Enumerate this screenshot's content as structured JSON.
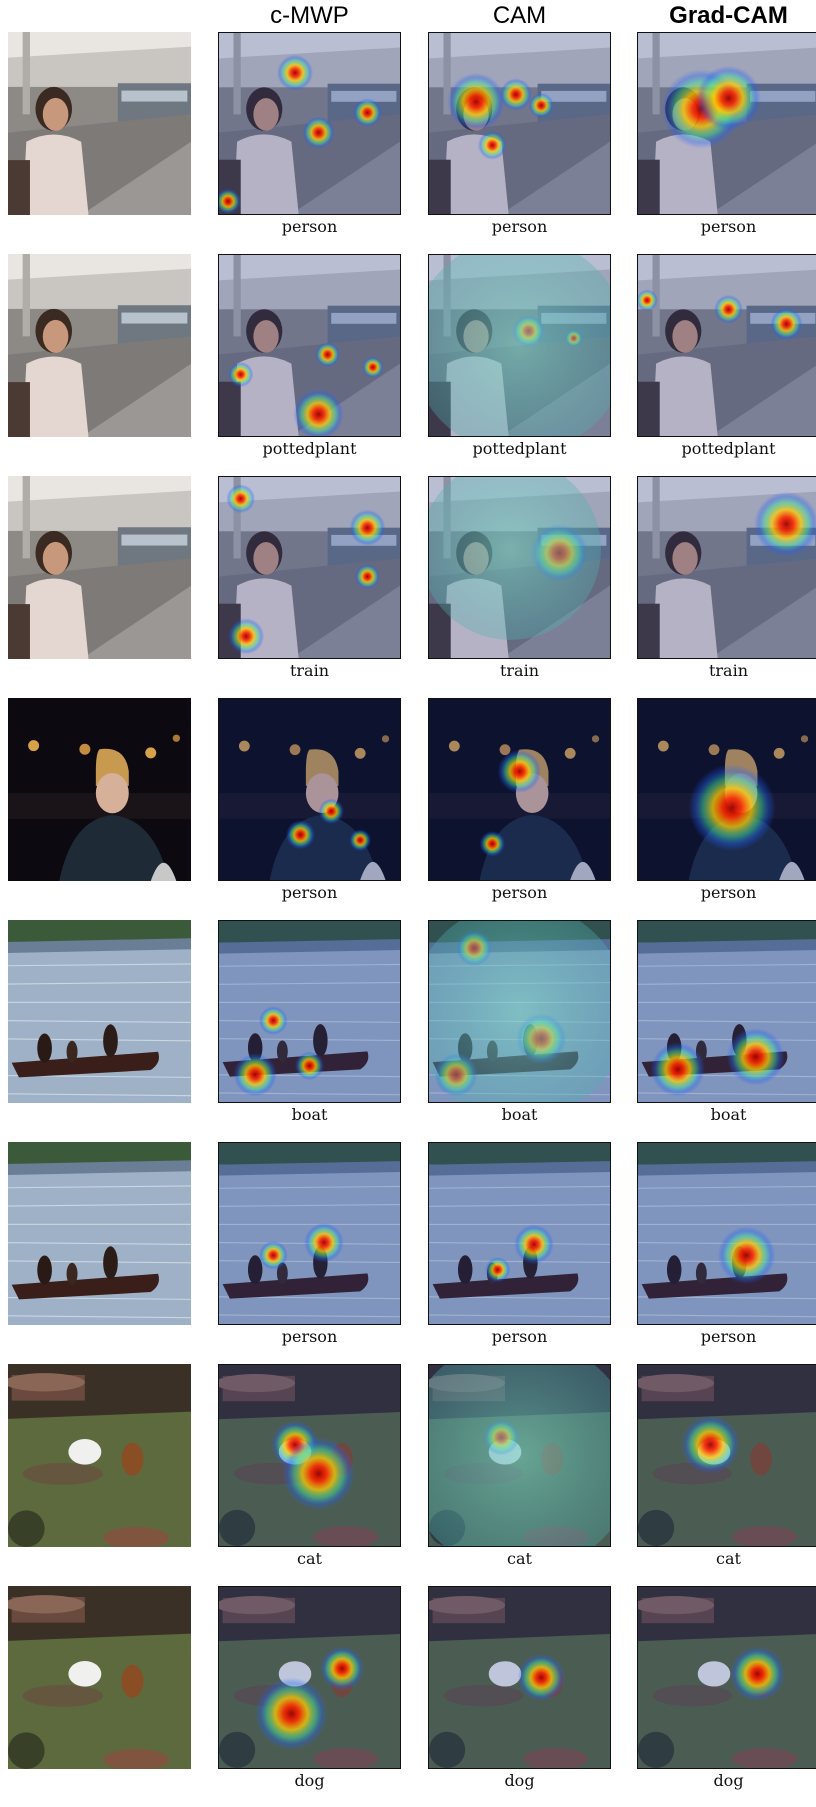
{
  "columns": {
    "original": "",
    "c_mwp": "c-MWP",
    "cam": "CAM",
    "grad_cam": "Grad-CAM"
  },
  "rows": [
    {
      "scene": "station",
      "label": "person",
      "heat": {
        "cmwp": [
          [
            0.42,
            0.22,
            0.1
          ],
          [
            0.82,
            0.44,
            0.08
          ],
          [
            0.05,
            0.93,
            0.07
          ],
          [
            0.55,
            0.55,
            0.09
          ]
        ],
        "cam": [
          [
            0.26,
            0.38,
            0.16
          ],
          [
            0.48,
            0.34,
            0.09
          ],
          [
            0.35,
            0.62,
            0.08
          ],
          [
            0.62,
            0.4,
            0.07
          ]
        ],
        "gradcam": [
          [
            0.35,
            0.42,
            0.22
          ],
          [
            0.5,
            0.36,
            0.18
          ]
        ]
      }
    },
    {
      "scene": "station",
      "label": "pottedplant",
      "heat": {
        "cmwp": [
          [
            0.55,
            0.88,
            0.14
          ],
          [
            0.12,
            0.66,
            0.07
          ],
          [
            0.6,
            0.55,
            0.07
          ],
          [
            0.85,
            0.62,
            0.06
          ]
        ],
        "cam": [
          [
            0.55,
            0.42,
            0.09
          ],
          [
            0.8,
            0.46,
            0.05
          ],
          [
            0.5,
            0.5,
            0.6
          ]
        ],
        "gradcam": [
          [
            0.82,
            0.38,
            0.09
          ],
          [
            0.5,
            0.3,
            0.08
          ],
          [
            0.05,
            0.25,
            0.06
          ]
        ]
      }
    },
    {
      "scene": "station",
      "label": "train",
      "heat": {
        "cmwp": [
          [
            0.82,
            0.28,
            0.1
          ],
          [
            0.15,
            0.88,
            0.1
          ],
          [
            0.82,
            0.55,
            0.07
          ],
          [
            0.12,
            0.12,
            0.08
          ]
        ],
        "cam": [
          [
            0.72,
            0.42,
            0.16
          ],
          [
            0.45,
            0.4,
            0.5
          ]
        ],
        "gradcam": [
          [
            0.82,
            0.26,
            0.18
          ]
        ]
      }
    },
    {
      "scene": "portrait",
      "label": "person",
      "heat": {
        "cmwp": [
          [
            0.45,
            0.75,
            0.08
          ],
          [
            0.62,
            0.62,
            0.07
          ],
          [
            0.78,
            0.78,
            0.06
          ]
        ],
        "cam": [
          [
            0.5,
            0.4,
            0.12
          ],
          [
            0.35,
            0.8,
            0.07
          ]
        ],
        "gradcam": [
          [
            0.52,
            0.6,
            0.24
          ]
        ]
      }
    },
    {
      "scene": "lake",
      "label": "boat",
      "heat": {
        "cmwp": [
          [
            0.2,
            0.85,
            0.12
          ],
          [
            0.5,
            0.8,
            0.08
          ],
          [
            0.3,
            0.55,
            0.08
          ]
        ],
        "cam": [
          [
            0.62,
            0.65,
            0.14
          ],
          [
            0.25,
            0.15,
            0.1
          ],
          [
            0.15,
            0.85,
            0.12
          ],
          [
            0.5,
            0.5,
            0.6
          ]
        ],
        "gradcam": [
          [
            0.22,
            0.82,
            0.15
          ],
          [
            0.65,
            0.75,
            0.16
          ]
        ]
      }
    },
    {
      "scene": "lake",
      "label": "person",
      "heat": {
        "cmwp": [
          [
            0.58,
            0.55,
            0.11
          ],
          [
            0.3,
            0.62,
            0.08
          ]
        ],
        "cam": [
          [
            0.58,
            0.56,
            0.11
          ],
          [
            0.38,
            0.7,
            0.07
          ]
        ],
        "gradcam": [
          [
            0.6,
            0.62,
            0.16
          ]
        ]
      }
    },
    {
      "scene": "garden",
      "label": "cat",
      "heat": {
        "cmwp": [
          [
            0.42,
            0.44,
            0.13
          ],
          [
            0.55,
            0.6,
            0.2
          ]
        ],
        "cam": [
          [
            0.4,
            0.4,
            0.1
          ],
          [
            0.5,
            0.5,
            0.65
          ]
        ],
        "gradcam": [
          [
            0.4,
            0.44,
            0.16
          ]
        ]
      }
    },
    {
      "scene": "garden",
      "label": "dog",
      "heat": {
        "cmwp": [
          [
            0.68,
            0.45,
            0.12
          ],
          [
            0.4,
            0.7,
            0.2
          ]
        ],
        "cam": [
          [
            0.62,
            0.5,
            0.13
          ]
        ],
        "gradcam": [
          [
            0.66,
            0.48,
            0.15
          ]
        ]
      }
    }
  ]
}
